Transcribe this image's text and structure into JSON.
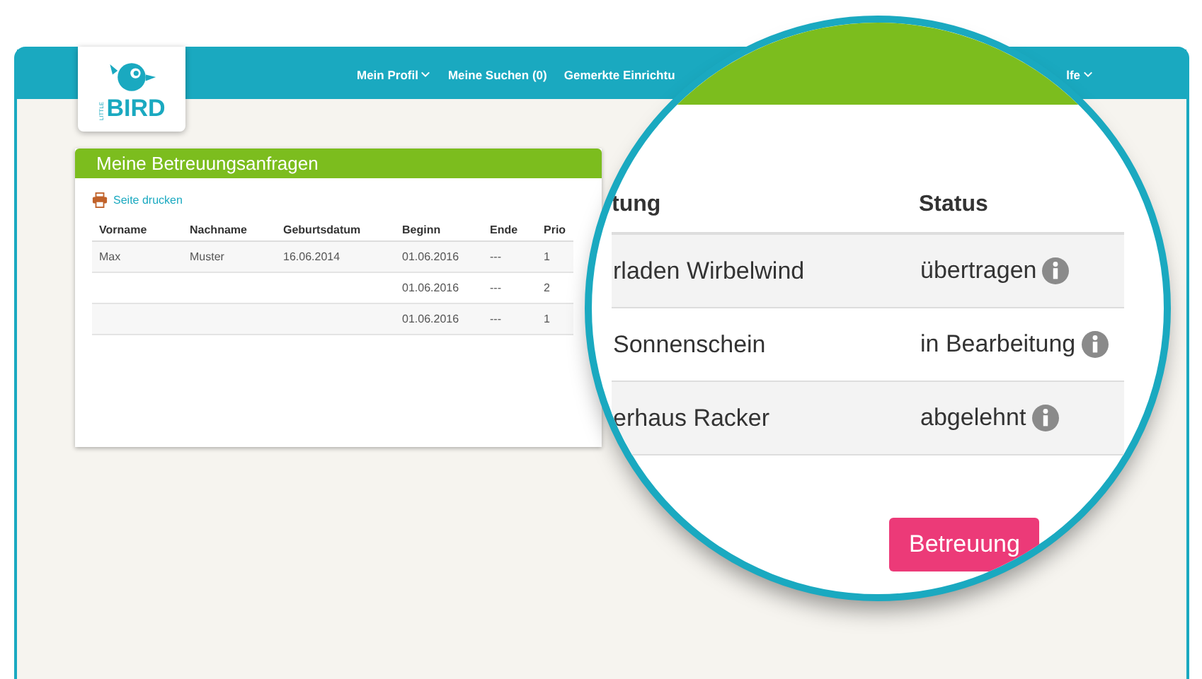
{
  "logo": {
    "small": "LITTLE",
    "big": "BIRD"
  },
  "nav": {
    "items": [
      {
        "label": "Mein Profil",
        "dropdown": true
      },
      {
        "label": "Meine Suchen (0)",
        "dropdown": false
      },
      {
        "label": "Gemerkte Einrichtu",
        "dropdown": false
      },
      {
        "label": "lfe",
        "dropdown": true
      }
    ]
  },
  "panel": {
    "title": "Meine Betreuungsanfragen",
    "print_link": "Seite drucken",
    "columns": [
      "Vorname",
      "Nachname",
      "Geburtsdatum",
      "Beginn",
      "Ende",
      "Prio"
    ],
    "rows": [
      [
        "Max",
        "Muster",
        "16.06.2014",
        "01.06.2016",
        "---",
        "1"
      ],
      [
        "",
        "",
        "",
        "01.06.2016",
        "---",
        "2"
      ],
      [
        "",
        "",
        "",
        "01.06.2016",
        "---",
        "1"
      ]
    ]
  },
  "magnifier": {
    "columns": [
      "tung",
      "Status"
    ],
    "rows": [
      {
        "facility": "rladen Wirbelwind",
        "status": "übertragen"
      },
      {
        "facility": "Sonnenschein",
        "status": "in Bearbeitung"
      },
      {
        "facility": "erhaus Racker",
        "status": "abgelehnt"
      }
    ],
    "button": "Betreuung"
  }
}
